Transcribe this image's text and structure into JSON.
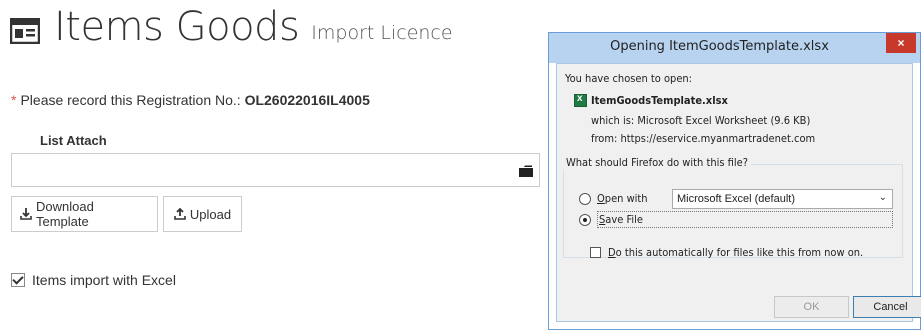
{
  "header": {
    "title": "Items Goods",
    "subtitle": "Import Licence",
    "icon": "list-icon"
  },
  "notice": {
    "star": "*",
    "text": "Please record this Registration No.:",
    "reg_no": "OL26022016IL4005"
  },
  "attach": {
    "label": "List Attach",
    "value": "",
    "icon": "folder-icon"
  },
  "buttons": {
    "download": "Download Template",
    "upload": "Upload"
  },
  "checkbox": {
    "label": "Items import with Excel",
    "checked": true
  },
  "dialog": {
    "title": "Opening ItemGoodsTemplate.xlsx",
    "close": "×",
    "intro": "You have chosen to open:",
    "filename": "ItemGoodsTemplate.xlsx",
    "which_is": "which is: Microsoft Excel Worksheet (9.6 KB)",
    "from": "from: https://eservice.myanmartradenet.com",
    "question": "What should Firefox do with this file?",
    "open_with_label_o": "O",
    "open_with_label_rest": "pen with",
    "open_with_app": "Microsoft Excel (default)",
    "save_file_s": "S",
    "save_file_rest": "ave File",
    "auto_d": "D",
    "auto_rest": "o this automatically for files like this from now on.",
    "ok": "OK",
    "cancel": "Cancel",
    "selected_option": "save-file"
  }
}
